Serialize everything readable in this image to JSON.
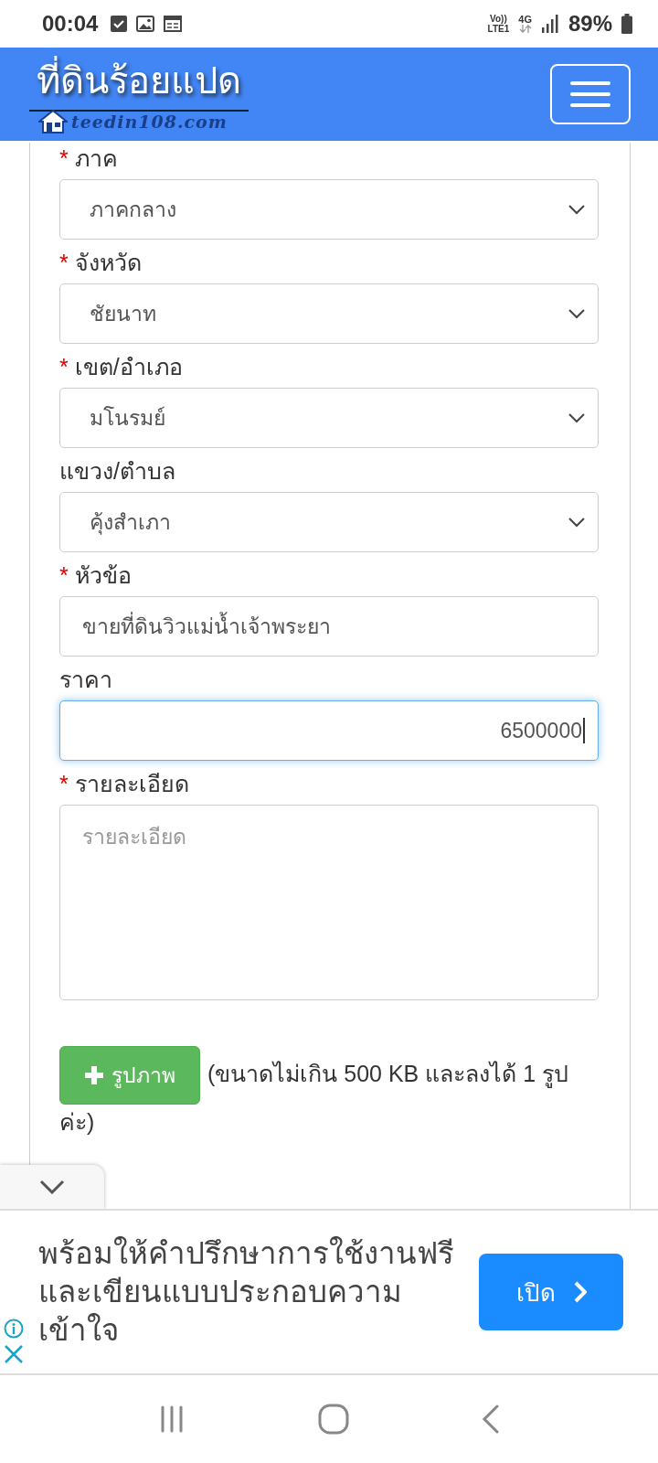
{
  "status_bar": {
    "time": "00:04",
    "volte_top": "Vo))",
    "volte_bottom": "LTE1",
    "network_type": "4G",
    "battery": "89%"
  },
  "header": {
    "logo_text": "ที่ดินร้อยแปด",
    "logo_url": "teedin108.com"
  },
  "form": {
    "fields": [
      {
        "label": "ภาค",
        "required_mark": "*",
        "kind": "select",
        "value": "ภาคกลาง",
        "focused": false
      },
      {
        "label": "จังหวัด",
        "required_mark": "*",
        "kind": "select",
        "value": "ชัยนาท",
        "focused": false
      },
      {
        "label": "เขต/อำเภอ",
        "required_mark": "*",
        "kind": "select",
        "value": "มโนรมย์",
        "focused": false
      },
      {
        "label": "แขวง/ตำบล",
        "kind": "select",
        "value": "คุ้งสำเภา",
        "focused": false
      },
      {
        "label": "หัวข้อ",
        "required_mark": "*",
        "kind": "text",
        "value": "ขายที่ดินวิวแม่น้ำเจ้าพระยา",
        "focused": false
      },
      {
        "label": "ราคา",
        "kind": "number",
        "value": "6500000",
        "focused": true
      },
      {
        "label": "รายละเอียด",
        "required_mark": "*",
        "kind": "textarea",
        "placeholder": "รายละเอียด",
        "focused": false
      }
    ],
    "upload_button": "รูปภาพ",
    "upload_note": "(ขนาดไม่เกิน 500 KB และลงได้ 1 รูปค่ะ)"
  },
  "ad": {
    "text": "พร้อมให้คำปรึกษาการใช้งานฟรี และเขียนแบบประกอบความเข้าใจ",
    "button": "เปิด"
  }
}
